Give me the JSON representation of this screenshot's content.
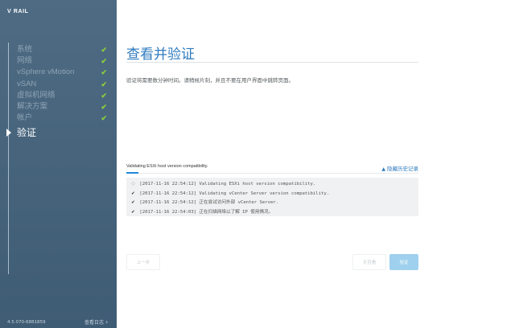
{
  "sidebar": {
    "logo": "V RAIL",
    "steps": [
      {
        "label": "系统",
        "done": true
      },
      {
        "label": "网络",
        "done": true
      },
      {
        "label": "vSphere vMotion",
        "done": true
      },
      {
        "label": "vSAN",
        "done": true
      },
      {
        "label": "虚拟机网络",
        "done": true
      },
      {
        "label": "解决方案",
        "done": true
      },
      {
        "label": "帐户",
        "done": true
      },
      {
        "label": "验证",
        "done": false,
        "active": true
      }
    ],
    "check_icon": "✔",
    "version": "4.5.070-6881859",
    "view_log_label": "查看日志",
    "view_log_chevron": "›"
  },
  "main": {
    "title": "查看并验证",
    "description": "验证将需要数分钟时间。请稍候片刻，并且不要在用户界面中跳转页面。",
    "progress_label": "Validating ESXi host version compatibility.",
    "progress_fraction": 0.04,
    "history_link": "隐藏历史记录",
    "history_caret": "▲",
    "log": [
      {
        "icon": "spinner",
        "glyph": "◌",
        "text": "[2017-11-16 22:54:12] Validating ESXi host version compatibility."
      },
      {
        "icon": "check",
        "glyph": "✔",
        "text": "[2017-11-16 22:54:12] Validating vCenter Server version compatibility."
      },
      {
        "icon": "check",
        "glyph": "✔",
        "text": "[2017-11-16 22:54:12] 正在尝试访问外部 vCenter Server."
      },
      {
        "icon": "check",
        "glyph": "✔",
        "text": "[2017-11-16 22:54:03] 正在扫描网络以了解 IP 使用情况。"
      }
    ],
    "buttons": {
      "prev": "上一步",
      "skip": "无否看",
      "verify": "验证"
    }
  },
  "colors": {
    "sidebar_bg": "#4e6b83",
    "accent_blue": "#2f7bbf",
    "check_green": "#8ccf3a",
    "verify_button": "#9fd0ee"
  }
}
